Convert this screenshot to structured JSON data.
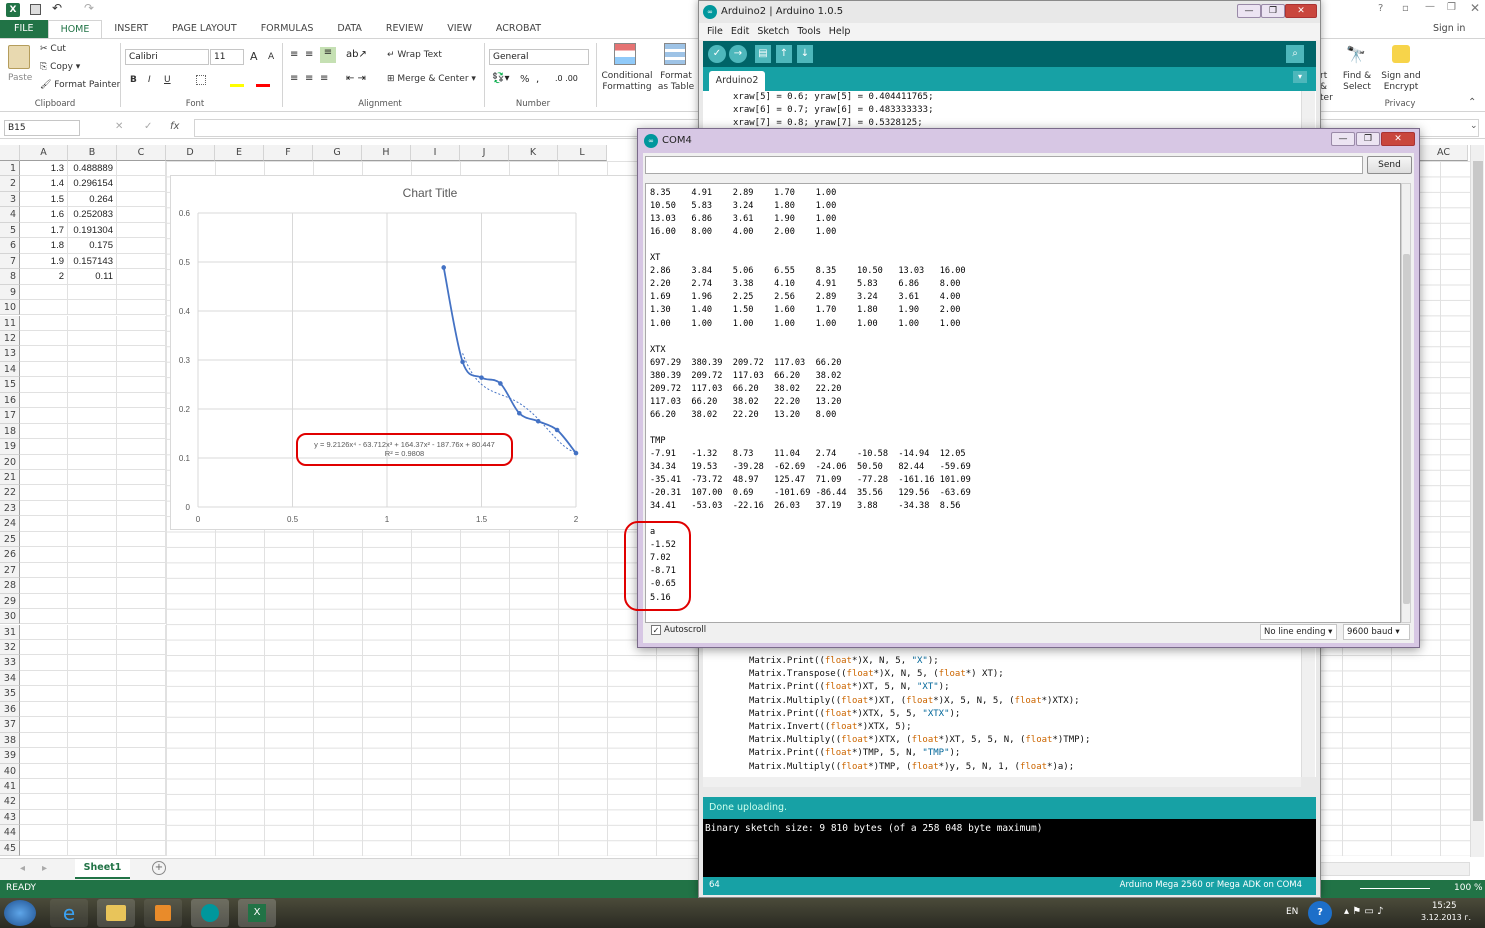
{
  "excel": {
    "tabs": [
      "FILE",
      "HOME",
      "INSERT",
      "PAGE LAYOUT",
      "FORMULAS",
      "DATA",
      "REVIEW",
      "VIEW",
      "ACROBAT"
    ],
    "sign_in": "Sign in",
    "clipboard": {
      "paste": "Paste",
      "cut": "Cut",
      "copy": "Copy",
      "format_painter": "Format Painter",
      "label": "Clipboard"
    },
    "font": {
      "name": "Calibri",
      "size": "11",
      "label": "Font",
      "grow": "A",
      "shrink": "A",
      "bold": "B",
      "italic": "I",
      "underline": "U"
    },
    "alignment": {
      "wrap": "Wrap Text",
      "merge": "Merge & Center",
      "label": "Alignment"
    },
    "number": {
      "format": "General",
      "label": "Number",
      "percent": "%"
    },
    "styles": {
      "conditional": "Conditional Formatting",
      "format_as": "Format as Table"
    },
    "right_ribbon": {
      "filter": "rt & ter",
      "find": "Find & Select",
      "sign": "Sign and Encrypt",
      "privacy": "Privacy"
    },
    "name_box": "B15",
    "fx": "fx",
    "columns": [
      "A",
      "B",
      "C",
      "D",
      "E",
      "F",
      "G",
      "H",
      "I",
      "J",
      "K",
      "L"
    ],
    "col_right": "AC",
    "rows": [
      "1",
      "2",
      "3",
      "4",
      "5",
      "6",
      "7",
      "8",
      "9",
      "10",
      "11",
      "12",
      "13",
      "14",
      "15",
      "16",
      "17",
      "18",
      "19",
      "20",
      "21",
      "22",
      "23",
      "24",
      "25",
      "26",
      "27",
      "28",
      "29",
      "30",
      "31",
      "32",
      "33",
      "34",
      "35",
      "36",
      "37",
      "38",
      "39",
      "40",
      "41",
      "42",
      "43",
      "44",
      "45"
    ],
    "cells_a": [
      "1.3",
      "1.4",
      "1.5",
      "1.6",
      "1.7",
      "1.8",
      "1.9",
      "2"
    ],
    "cells_b": [
      "0.488889",
      "0.296154",
      "0.264",
      "0.252083",
      "0.191304",
      "0.175",
      "0.157143",
      "0.11"
    ],
    "sheet_tab": "Sheet1",
    "status": "READY",
    "zoom": "100 %"
  },
  "chart_data": {
    "type": "scatter",
    "title": "Chart Title",
    "x": [
      1.3,
      1.4,
      1.5,
      1.6,
      1.7,
      1.8,
      1.9,
      2.0
    ],
    "y": [
      0.488889,
      0.296154,
      0.264,
      0.252083,
      0.191304,
      0.175,
      0.157143,
      0.11
    ],
    "xlim": [
      0,
      2
    ],
    "ylim": [
      0,
      0.6
    ],
    "xticks": [
      "0",
      "0.5",
      "1",
      "1.5",
      "2"
    ],
    "yticks": [
      "0",
      "0.1",
      "0.2",
      "0.3",
      "0.4",
      "0.5",
      "0.6"
    ],
    "trendline": "polynomial (order 4)",
    "equation": "y = 9.2126x⁴ - 63.712x³ + 164.37x² - 187.76x + 80.447",
    "r2": "R² = 0.9808",
    "series_color": "#4472c4",
    "grid": true
  },
  "arduino": {
    "title": "Arduino2 | Arduino 1.0.5",
    "menu": [
      "File",
      "Edit",
      "Sketch",
      "Tools",
      "Help"
    ],
    "tab": "Arduino2",
    "code_top": [
      "xraw[5] = 0.6; yraw[5] = 0.404411765;",
      "xraw[6] = 0.7; yraw[6] = 0.483333333;",
      "xraw[7] = 0.8; yraw[7] = 0.5328125;"
    ],
    "code_bottom": [
      [
        "Matrix.Print((",
        "float",
        "*)X, N, 5, ",
        "\"X\"",
        ");"
      ],
      [
        "Matrix.Transpose((",
        "float",
        "*)X, N, 5, (",
        "float",
        "*) XT);"
      ],
      [
        "Matrix.Print((",
        "float",
        "*)XT, 5, N, ",
        "\"XT\"",
        ");"
      ],
      [
        "Matrix.Multiply((",
        "float",
        "*)XT, (",
        "float",
        "*)X, 5, N, 5, (",
        "float",
        "*)XTX);"
      ],
      [
        "Matrix.Print((",
        "float",
        "*)XTX, 5, 5, ",
        "\"XTX\"",
        ");"
      ],
      [
        "Matrix.Invert((",
        "float",
        "*)XTX, 5);"
      ],
      [
        "Matrix.Multiply((",
        "float",
        "*)XTX, (",
        "float",
        "*)XT, 5, 5, N, (",
        "float",
        "*)TMP);"
      ],
      [
        "Matrix.Print((",
        "float",
        "*)TMP, 5, N, ",
        "\"TMP\"",
        ");"
      ],
      [
        "Matrix.Multiply((",
        "float",
        "*)TMP, (",
        "float",
        "*)y, 5, N, 1, (",
        "float",
        "*)a);"
      ]
    ],
    "status": "Done uploading.",
    "console": "Binary sketch size: 9 810 bytes (of a 258 048 byte maximum)",
    "line": "64",
    "board": "Arduino Mega 2560 or Mega ADK on COM4"
  },
  "com4": {
    "title": "COM4",
    "send": "Send",
    "autoscroll": "Autoscroll",
    "line_ending": "No line ending",
    "baud": "9600 baud",
    "output": [
      "8.35    4.91    2.89    1.70    1.00",
      "10.50   5.83    3.24    1.80    1.00",
      "13.03   6.86    3.61    1.90    1.00",
      "16.00   8.00    4.00    2.00    1.00",
      "",
      "XT",
      "2.86    3.84    5.06    6.55    8.35    10.50   13.03   16.00",
      "2.20    2.74    3.38    4.10    4.91    5.83    6.86    8.00",
      "1.69    1.96    2.25    2.56    2.89    3.24    3.61    4.00",
      "1.30    1.40    1.50    1.60    1.70    1.80    1.90    2.00",
      "1.00    1.00    1.00    1.00    1.00    1.00    1.00    1.00",
      "",
      "XTX",
      "697.29  380.39  209.72  117.03  66.20",
      "380.39  209.72  117.03  66.20   38.02",
      "209.72  117.03  66.20   38.02   22.20",
      "117.03  66.20   38.02   22.20   13.20",
      "66.20   38.02   22.20   13.20   8.00",
      "",
      "TMP",
      "-7.91   -1.32   8.73    11.04   2.74    -10.58  -14.94  12.05",
      "34.34   19.53   -39.28  -62.69  -24.06  50.50   82.44   -59.69",
      "-35.41  -73.72  48.97   125.47  71.09   -77.28  -161.16 101.09",
      "-20.31  107.00  0.69    -101.69 -86.44  35.56   129.56  -63.69",
      "34.41   -53.03  -22.16  26.03   37.19   3.88    -34.38  8.56",
      "",
      "a",
      "-1.52",
      "7.02",
      "-8.71",
      "-0.65",
      "5.16"
    ]
  },
  "taskbar": {
    "lang": "EN",
    "time": "15:25",
    "date": "3.12.2013 г."
  }
}
